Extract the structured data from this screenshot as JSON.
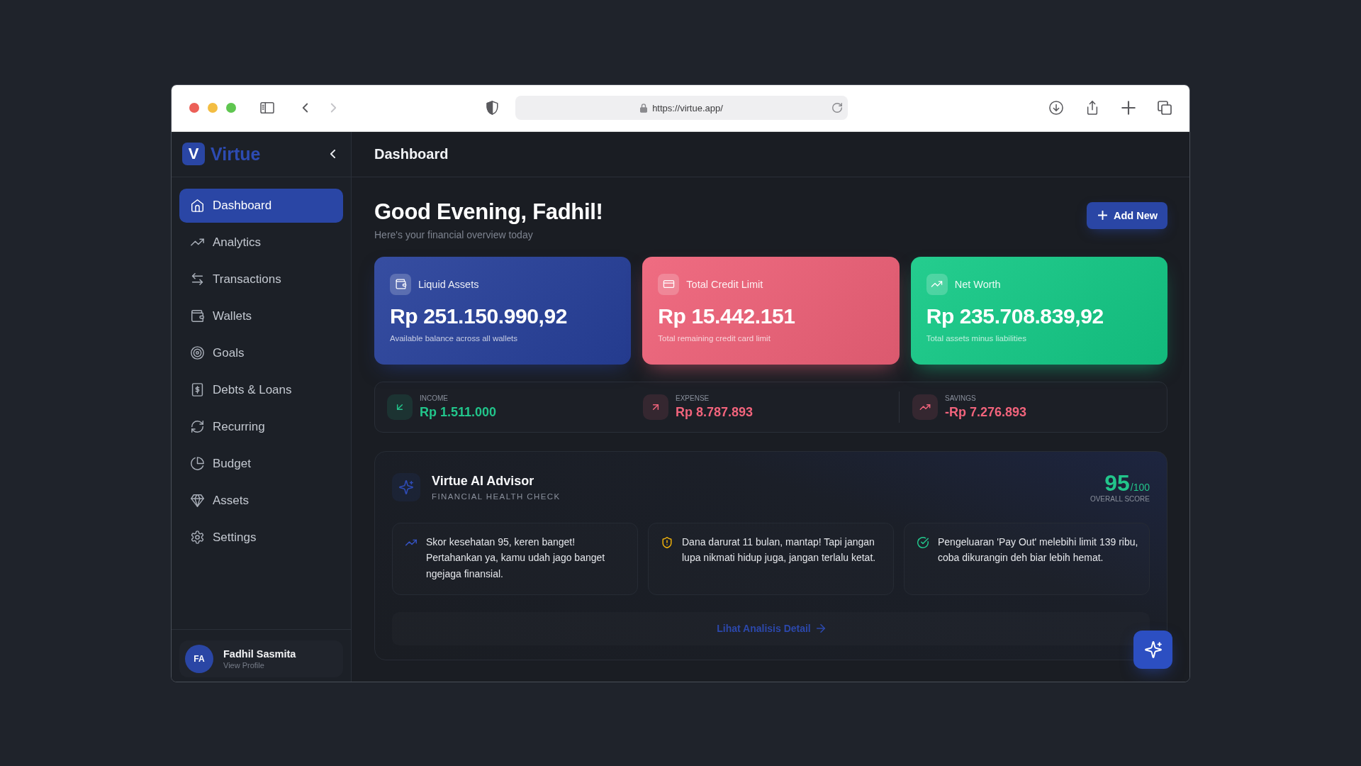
{
  "browser": {
    "url": "https://virtue.app/",
    "back_disabled": false,
    "forward_disabled": true
  },
  "sidebar": {
    "brand_mark": "V",
    "brand_name": "Virtue",
    "items": [
      {
        "label": "Dashboard",
        "selected": true
      },
      {
        "label": "Analytics",
        "selected": false
      },
      {
        "label": "Transactions",
        "selected": false
      },
      {
        "label": "Wallets",
        "selected": false
      },
      {
        "label": "Goals",
        "selected": false
      },
      {
        "label": "Debts & Loans",
        "selected": false
      },
      {
        "label": "Recurring",
        "selected": false
      },
      {
        "label": "Budget",
        "selected": false
      },
      {
        "label": "Assets",
        "selected": false
      },
      {
        "label": "Settings",
        "selected": false
      }
    ],
    "profile": {
      "initials": "FA",
      "name": "Fadhil Sasmita",
      "subtitle": "View Profile"
    }
  },
  "header": {
    "title": "Dashboard"
  },
  "greeting": {
    "title": "Good Evening, Fadhil!",
    "subtitle": "Here's your financial overview today",
    "button": "Add New"
  },
  "summary_cards": [
    {
      "label": "Liquid Assets",
      "amount": "Rp 251.150.990,92",
      "caption": "Available balance across all wallets",
      "color": "#27409a"
    },
    {
      "label": "Total Credit Limit",
      "amount": "Rp 15.442.151",
      "caption": "Total remaining credit card limit",
      "color": "#ee6178"
    },
    {
      "label": "Net Worth",
      "amount": "Rp 235.708.839,92",
      "caption": "Total assets minus liabilities",
      "color": "#14c986"
    }
  ],
  "cash_flow": [
    {
      "label": "INCOME",
      "amount": "Rp 1.511.000",
      "color": "#22c58b"
    },
    {
      "label": "EXPENSE",
      "amount": "Rp 8.787.893",
      "color": "#f2647c"
    },
    {
      "label": "SAVINGS",
      "amount": "-Rp 7.276.893",
      "color": "#f2647c"
    }
  ],
  "advisor": {
    "title": "Virtue AI Advisor",
    "subtitle": "FINANCIAL HEALTH CHECK",
    "score": "95",
    "score_max": "/100",
    "score_label": "OVERALL SCORE",
    "insights": [
      {
        "kind": "trend",
        "text": "Skor kesehatan 95, keren banget! Pertahankan ya, kamu udah jago banget ngejaga finansial."
      },
      {
        "kind": "warning",
        "text": "Dana darurat 11 bulan, mantap! Tapi jangan lupa nikmati hidup juga, jangan terlalu ketat."
      },
      {
        "kind": "check",
        "text": "Pengeluaran 'Pay Out' melebihi limit 139 ribu, coba dikurangin deh biar lebih hemat."
      }
    ],
    "link": "Lihat Analisis Detail"
  }
}
